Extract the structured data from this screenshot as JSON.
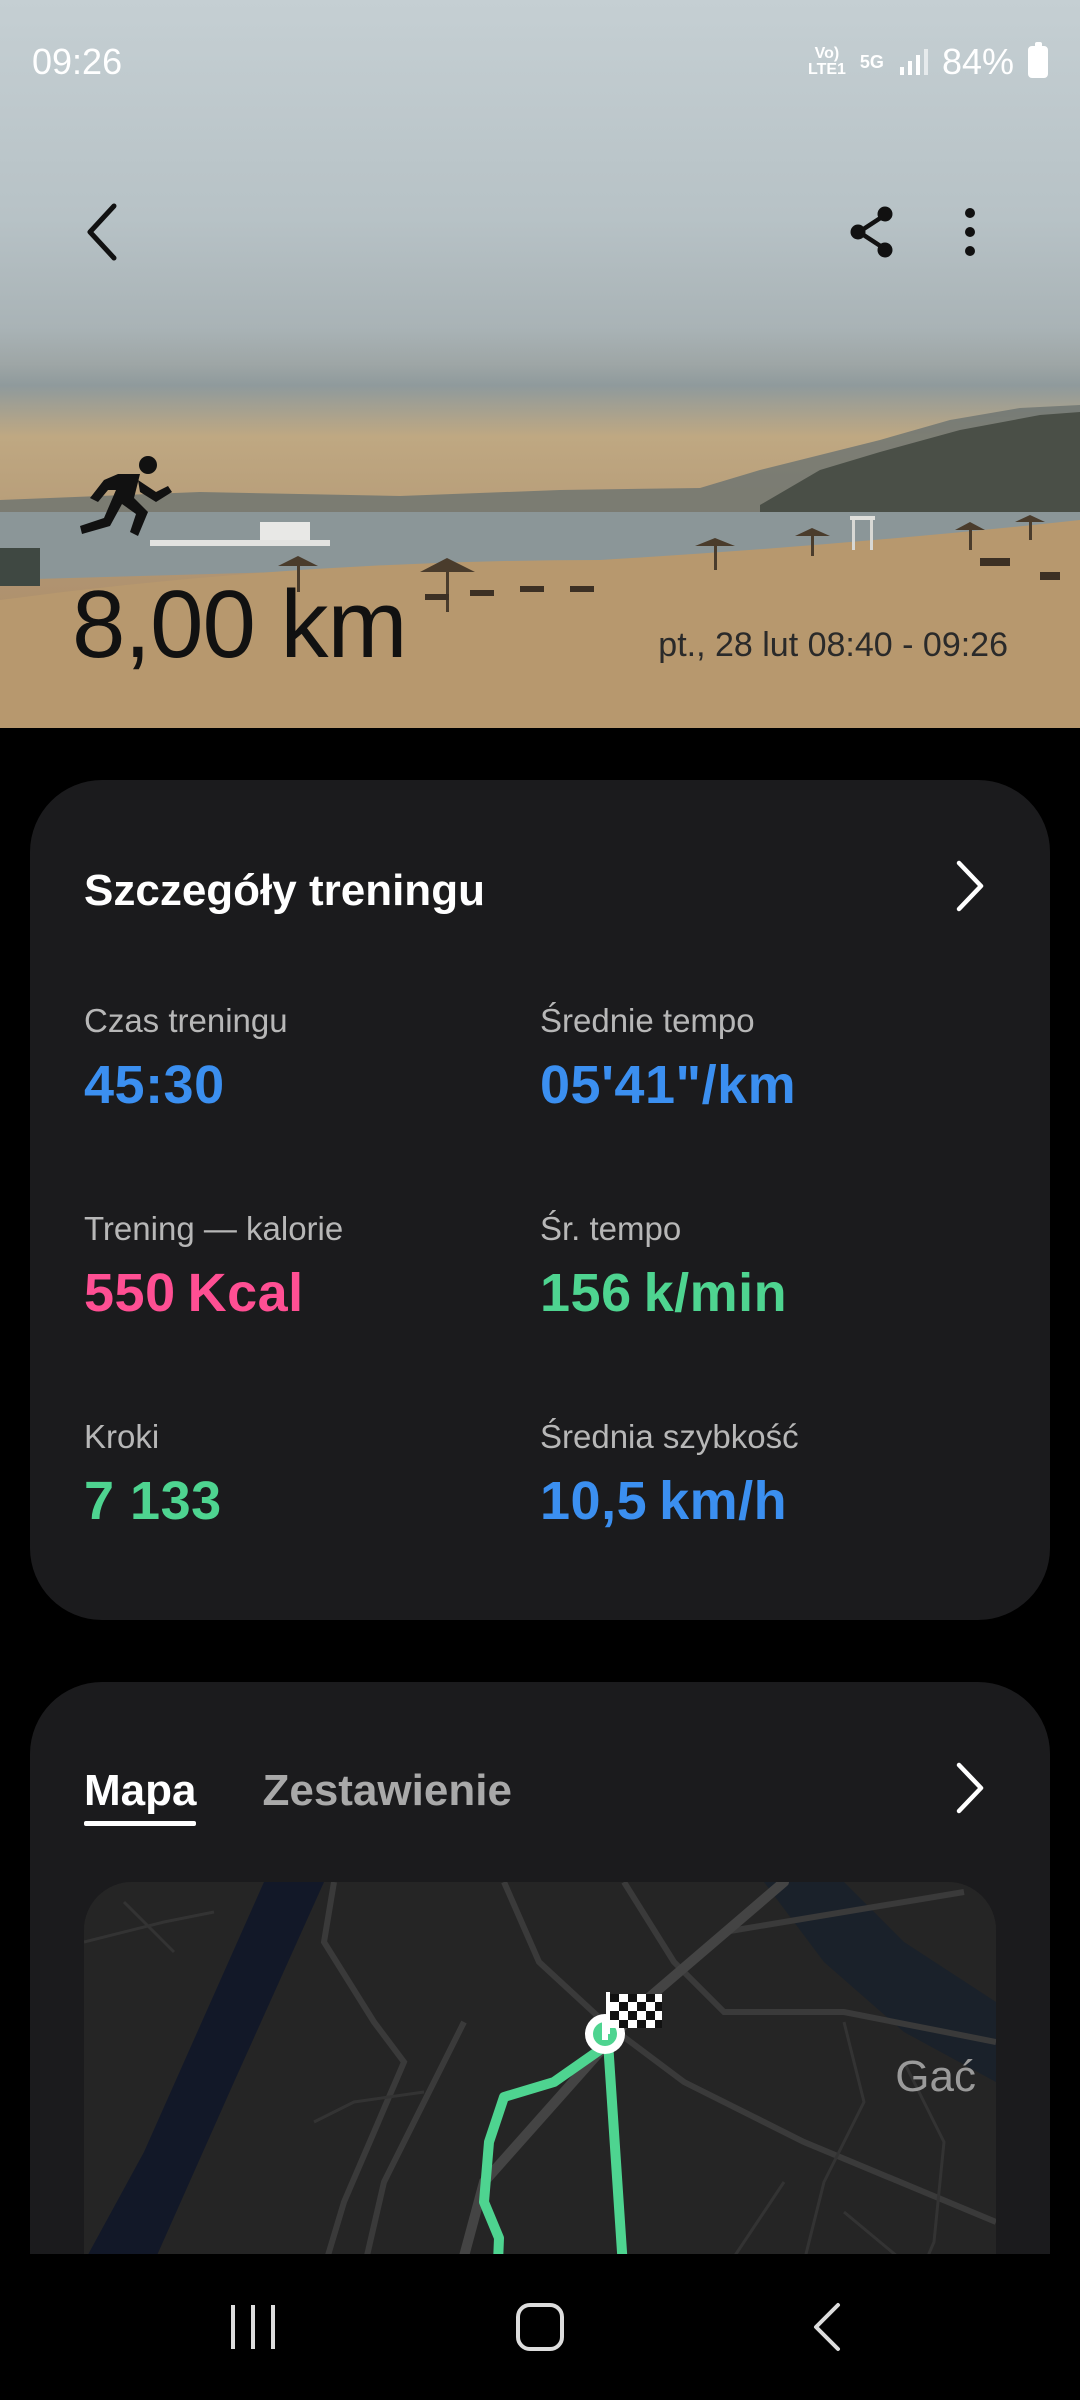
{
  "status_bar": {
    "time": "09:26",
    "network_badge_top": "Vo)",
    "network_badge_bottom": "LTE1",
    "network_type": "5G",
    "battery": "84%"
  },
  "hero": {
    "distance": "8,00 km",
    "date_range": "pt., 28 lut 08:40 - 09:26",
    "activity_icon": "running-person-icon"
  },
  "details": {
    "title": "Szczegóły treningu",
    "metrics": [
      {
        "label": "Czas treningu",
        "value": "45:30",
        "unit": "",
        "color": "#3b8ff0"
      },
      {
        "label": "Średnie tempo",
        "value": "05'41\"/km",
        "unit": "",
        "color": "#3b8ff0"
      },
      {
        "label": "Trening — kalorie",
        "value": "550",
        "unit": "Kcal",
        "color": "#ff4f93"
      },
      {
        "label": "Śr. tempo",
        "value": "156",
        "unit": "k/min",
        "color": "#4ed490"
      },
      {
        "label": "Kroki",
        "value": "7 133",
        "unit": "",
        "color": "#4ed490"
      },
      {
        "label": "Średnia szybkość",
        "value": "10,5",
        "unit": "km/h",
        "color": "#3b8ff0"
      }
    ]
  },
  "map_card": {
    "tabs": [
      {
        "label": "Mapa",
        "active": true
      },
      {
        "label": "Zestawienie",
        "active": false
      }
    ],
    "place_label": "Gać",
    "route_color": "#4ed490"
  },
  "navbar": {
    "icons": [
      "recent-apps-icon",
      "home-icon",
      "back-icon"
    ]
  }
}
